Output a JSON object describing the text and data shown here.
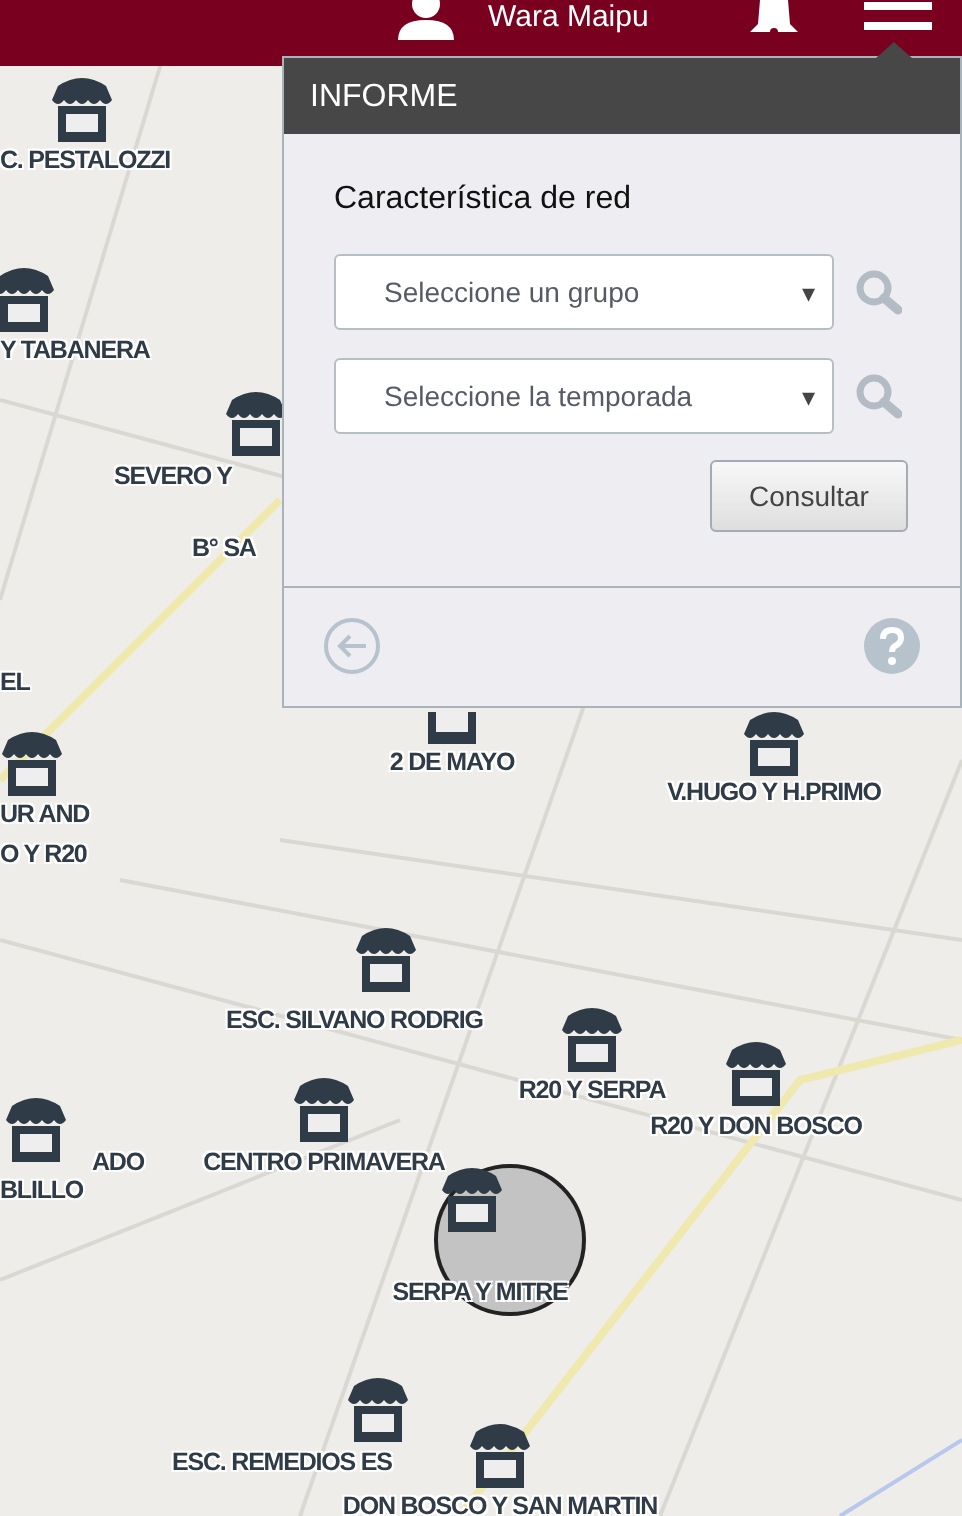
{
  "header": {
    "user_name": "Wara Maipu"
  },
  "panel": {
    "title": "INFORME",
    "section_label": "Característica de red",
    "selects": [
      {
        "placeholder": "Seleccione un grupo",
        "arrow": "▾"
      },
      {
        "placeholder": "Seleccione la temporada",
        "arrow": "▾"
      }
    ],
    "button": "Consultar"
  },
  "map": {
    "markers": [
      {
        "label": "C. PESTALOZZI"
      },
      {
        "label": "Y TABANERA"
      },
      {
        "label": "SEVERO Y"
      },
      {
        "label": "B° SA"
      },
      {
        "label": "EL"
      },
      {
        "label": "UR AND"
      },
      {
        "label": "O Y R20"
      },
      {
        "label": "2 DE MAYO"
      },
      {
        "label": "V.HUGO Y H.PRIMO"
      },
      {
        "label": "ESC. SILVANO RODRIG"
      },
      {
        "label": "R20 Y SERPA"
      },
      {
        "label": "R20 Y DON BOSCO"
      },
      {
        "label": "ADO"
      },
      {
        "label": "CENTRO PRIMAVERA"
      },
      {
        "label": "BLILLO"
      },
      {
        "label": "SERPA Y MITRE"
      },
      {
        "label": "ESC. REMEDIOS ES"
      },
      {
        "label": "DON BOSCO Y SAN MARTIN"
      }
    ]
  }
}
